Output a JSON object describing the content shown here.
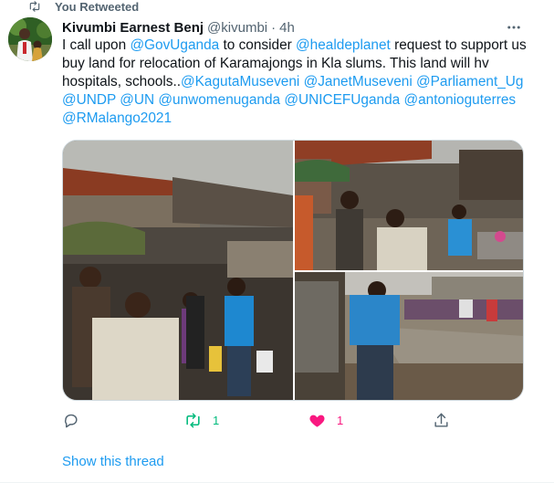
{
  "retweet_banner": {
    "label": "You Retweeted",
    "icon": "retweet-icon"
  },
  "author": {
    "name": "Kivumbi Earnest Benj",
    "handle": "@kivumbi",
    "separator": "·",
    "time": "4h"
  },
  "tweet": {
    "segments": [
      {
        "t": "I call upon ",
        "link": false
      },
      {
        "t": "@GovUganda",
        "link": true
      },
      {
        "t": " to consider ",
        "link": false
      },
      {
        "t": "@healdeplanet",
        "link": true
      },
      {
        "t": " request to support us buy land for relocation of Karamajongs in Kla slums. This land will hv hospitals, schools..",
        "link": false
      },
      {
        "t": "@KagutaMuseveni",
        "link": true
      },
      {
        "t": " ",
        "link": false
      },
      {
        "t": "@JanetMuseveni",
        "link": true
      },
      {
        "t": " ",
        "link": false
      },
      {
        "t": "@Parliament_Ug",
        "link": true
      },
      {
        "t": " ",
        "link": false
      },
      {
        "t": "@UNDP",
        "link": true
      },
      {
        "t": " ",
        "link": false
      },
      {
        "t": "@UN",
        "link": true
      },
      {
        "t": " ",
        "link": false
      },
      {
        "t": "@unwomenuganda",
        "link": true
      },
      {
        "t": " ",
        "link": false
      },
      {
        "t": "@UNICEFUganda",
        "link": true
      },
      {
        "t": " ",
        "link": false
      },
      {
        "t": "@antonioguterres",
        "link": true
      },
      {
        "t": " ",
        "link": false
      },
      {
        "t": "@RMalango2021",
        "link": true
      }
    ]
  },
  "actions": {
    "reply": {
      "icon": "reply-icon",
      "count": ""
    },
    "retweet": {
      "icon": "retweet-icon",
      "count": "1",
      "active": true
    },
    "like": {
      "icon": "heart-filled-icon",
      "count": "1",
      "active": true
    },
    "share": {
      "icon": "share-icon",
      "count": ""
    }
  },
  "show_thread": "Show this thread",
  "colors": {
    "link": "#1d9bf0",
    "muted": "#536471",
    "retweet_active": "#00ba7c",
    "like_active": "#f91880",
    "border": "#cfd9de"
  }
}
